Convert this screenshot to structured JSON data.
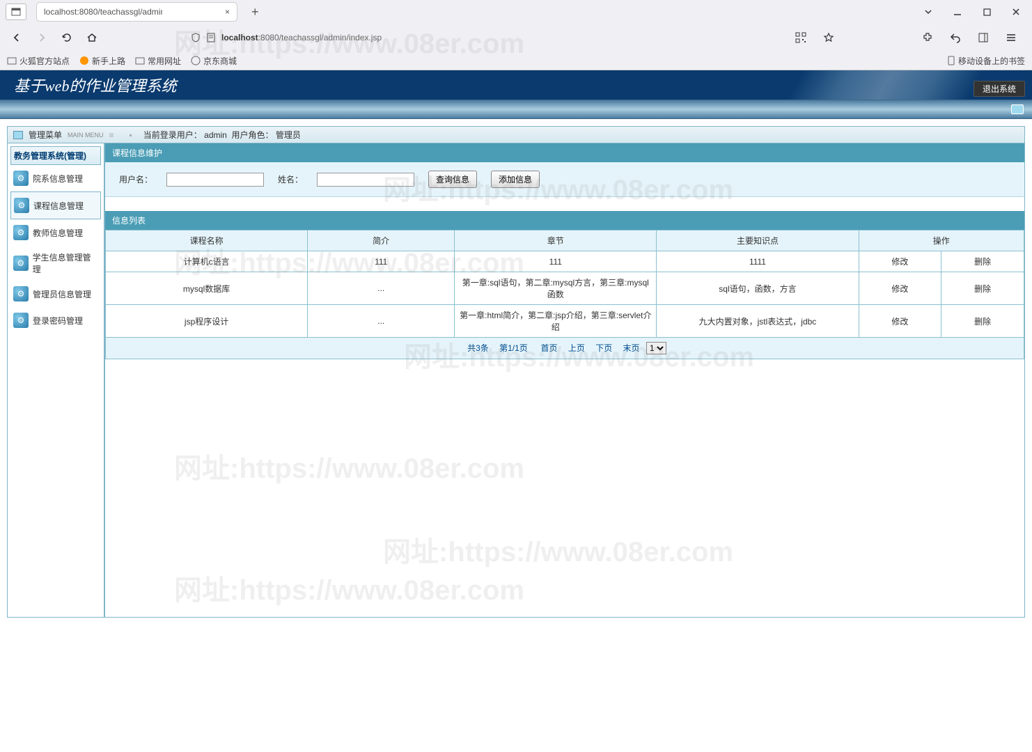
{
  "browser": {
    "tab_title": "localhost:8080/teachassgl/admin",
    "url_host": "localhost",
    "url_port_path": ":8080/teachassgl/admin/index.jsp"
  },
  "bookmarks": {
    "b1": "火狐官方站点",
    "b2": "新手上路",
    "b3": "常用网址",
    "b4": "京东商城",
    "mobile": "移动设备上的书签"
  },
  "app": {
    "title": "基于web的作业管理系统",
    "logout": "退出系统"
  },
  "mgmt_bar": {
    "menu_label": "管理菜单",
    "main_menu": "MAIN MENU",
    "user_prefix": "当前登录用户：",
    "user": "admin",
    "role_prefix": "用户角色：",
    "role": "管理员"
  },
  "sidebar": {
    "header": "教务管理系统(管理)",
    "items": [
      {
        "label": "院系信息管理"
      },
      {
        "label": "课程信息管理"
      },
      {
        "label": "教师信息管理"
      },
      {
        "label": "学生信息管理管理"
      },
      {
        "label": "管理员信息管理"
      },
      {
        "label": "登录密码管理"
      }
    ]
  },
  "panel": {
    "title": "课程信息维护",
    "username_label": "用户名：",
    "name_label": "姓名：",
    "search_btn": "查询信息",
    "add_btn": "添加信息",
    "list_title": "信息列表"
  },
  "table": {
    "headers": [
      "课程名称",
      "简介",
      "章节",
      "主要知识点",
      "操作"
    ],
    "rows": [
      {
        "c0": "计算机c语言",
        "c1": "111",
        "c2": "111",
        "c3": "1111",
        "edit": "修改",
        "del": "删除"
      },
      {
        "c0": "mysql数据库",
        "c1": "...",
        "c2": "第一章:sql语句，第二章:mysql方言，第三章:mysql函数",
        "c3": "sql语句，函数，方言",
        "edit": "修改",
        "del": "删除"
      },
      {
        "c0": "jsp程序设计",
        "c1": "...",
        "c2": "第一章:html简介，第二章:jsp介绍，第三章:servlet介绍",
        "c3": "九大内置对象，jstl表达式，jdbc",
        "edit": "修改",
        "del": "删除"
      }
    ]
  },
  "pager": {
    "total": "共3条",
    "page": "第1/1页",
    "first": "首页",
    "prev": "上页",
    "next": "下页",
    "last": "末页",
    "select": "1"
  },
  "watermark": "网址:https://www.08er.com"
}
